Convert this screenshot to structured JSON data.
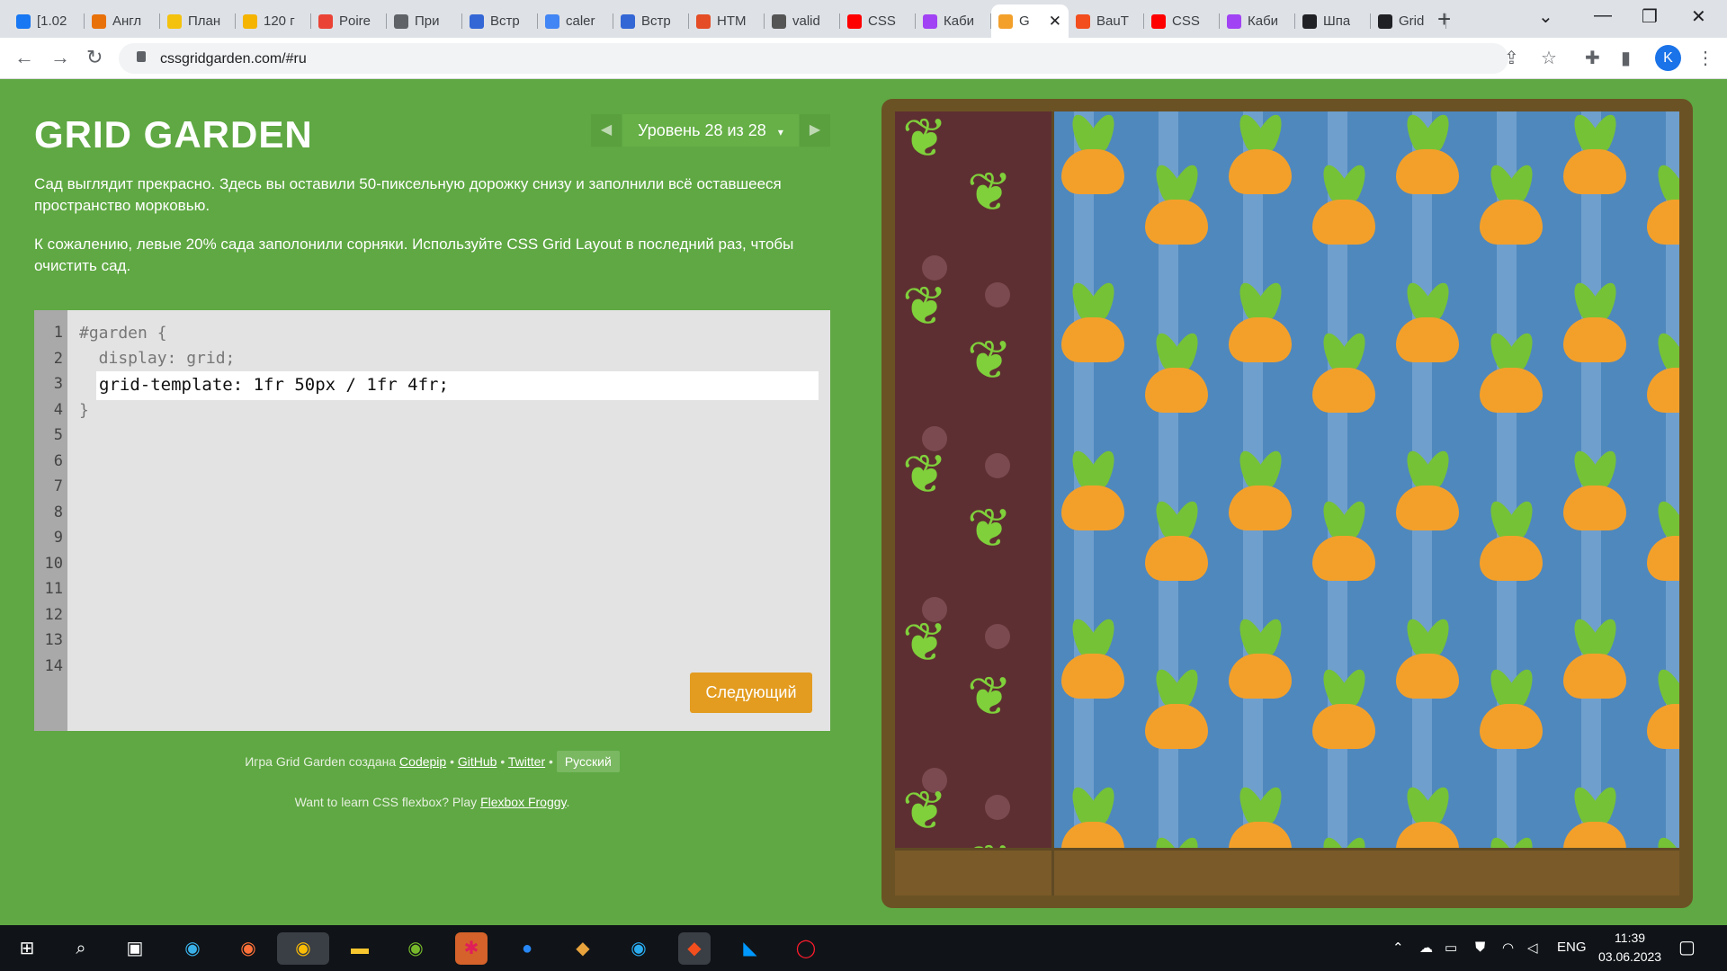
{
  "browser": {
    "tabs": [
      {
        "title": "[1.02",
        "color": "#1877f2"
      },
      {
        "title": "Англ",
        "color": "#e8710a"
      },
      {
        "title": "План",
        "color": "#f4c20d"
      },
      {
        "title": "120 г",
        "color": "#f4b400"
      },
      {
        "title": "Poire",
        "color": "#ea4335"
      },
      {
        "title": "При",
        "color": "#5f6368"
      },
      {
        "title": "Встр",
        "color": "#3367d6"
      },
      {
        "title": "caler",
        "color": "#4285f4"
      },
      {
        "title": "Встр",
        "color": "#3367d6"
      },
      {
        "title": "HTM",
        "color": "#e44d26"
      },
      {
        "title": "valid",
        "color": "#555555"
      },
      {
        "title": "CSS",
        "color": "#ff0000"
      },
      {
        "title": "Каби",
        "color": "#a142f4"
      },
      {
        "title": "G",
        "color": "#f3a02b",
        "active": true
      },
      {
        "title": "ВаuТ",
        "color": "#f24e1e"
      },
      {
        "title": "CSS",
        "color": "#ff0000"
      },
      {
        "title": "Каби",
        "color": "#a142f4"
      },
      {
        "title": "Шпа",
        "color": "#202124"
      },
      {
        "title": "Grid",
        "color": "#202124"
      }
    ],
    "url": "cssgridgarden.com/#ru",
    "profile_initial": "K"
  },
  "page": {
    "title": "GRID GARDEN",
    "level_label": "Уровень 28 из 28",
    "level_caret": "▾",
    "prev_arrow": "◀",
    "next_arrow": "▶",
    "description_1": "Сад выглядит прекрасно. Здесь вы оставили 50-пиксельную дорожку снизу и заполнили всё оставшееся пространство морковью.",
    "description_2": "К сожалению, левые 20% сада заполонили сорняки. Используйте CSS Grid Layout в последний раз, чтобы очистить сад.",
    "code_lines": [
      "1",
      "2",
      "3",
      "4",
      "5",
      "6",
      "7",
      "8",
      "9",
      "10",
      "11",
      "12",
      "13",
      "14"
    ],
    "code_open": "#garden {",
    "code_display": "  display: grid;",
    "code_input": "grid-template: 1fr 50px / 1fr 4fr;",
    "code_close": "}",
    "next_button": "Следующий",
    "credits_prefix": "Игра Grid Garden создана",
    "credits_codepip": "Codepip",
    "credits_github": "GitHub",
    "credits_twitter": "Twitter",
    "credits_sep": "•",
    "language_button": "Русский",
    "flexbox_prefix": "Want to learn CSS flexbox? Play",
    "flexbox_link": "Flexbox Froggy",
    "flexbox_suffix": "."
  },
  "taskbar": {
    "lang": "ENG",
    "time": "11:39",
    "date": "03.06.2023"
  }
}
